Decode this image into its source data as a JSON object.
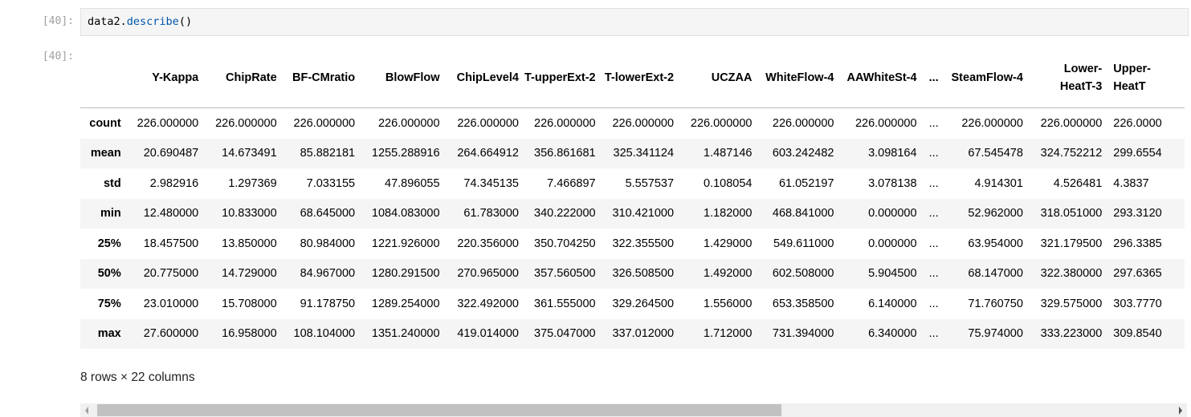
{
  "input": {
    "prompt": "[40]:",
    "code_object": "data2.",
    "code_method": "describe",
    "code_parens": "()"
  },
  "output": {
    "prompt": "[40]:",
    "table": {
      "columns": [
        "Y-Kappa",
        "ChipRate",
        "BF-CMratio",
        "BlowFlow",
        "ChipLevel4",
        "T-upperExt-2",
        "T-lowerExt-2",
        "UCZAA",
        "WhiteFlow-4",
        "AAWhiteSt-4",
        "...",
        "SteamFlow-4",
        "Lower-HeatT-3",
        "Upper-HeatT"
      ],
      "rows": [
        {
          "index": "count",
          "values": [
            "226.000000",
            "226.000000",
            "226.000000",
            "226.000000",
            "226.000000",
            "226.000000",
            "226.000000",
            "226.000000",
            "226.000000",
            "226.000000",
            "...",
            "226.000000",
            "226.000000",
            "226.0000"
          ]
        },
        {
          "index": "mean",
          "values": [
            "20.690487",
            "14.673491",
            "85.882181",
            "1255.288916",
            "264.664912",
            "356.861681",
            "325.341124",
            "1.487146",
            "603.242482",
            "3.098164",
            "...",
            "67.545478",
            "324.752212",
            "299.6554"
          ]
        },
        {
          "index": "std",
          "values": [
            "2.982916",
            "1.297369",
            "7.033155",
            "47.896055",
            "74.345135",
            "7.466897",
            "5.557537",
            "0.108054",
            "61.052197",
            "3.078138",
            "...",
            "4.914301",
            "4.526481",
            "4.3837"
          ]
        },
        {
          "index": "min",
          "values": [
            "12.480000",
            "10.833000",
            "68.645000",
            "1084.083000",
            "61.783000",
            "340.222000",
            "310.421000",
            "1.182000",
            "468.841000",
            "0.000000",
            "...",
            "52.962000",
            "318.051000",
            "293.3120"
          ]
        },
        {
          "index": "25%",
          "values": [
            "18.457500",
            "13.850000",
            "80.984000",
            "1221.926000",
            "220.356000",
            "350.704250",
            "322.355500",
            "1.429000",
            "549.611000",
            "0.000000",
            "...",
            "63.954000",
            "321.179500",
            "296.3385"
          ]
        },
        {
          "index": "50%",
          "values": [
            "20.775000",
            "14.729000",
            "84.967000",
            "1280.291500",
            "270.965000",
            "357.560500",
            "326.508500",
            "1.492000",
            "602.508000",
            "5.904500",
            "...",
            "68.147000",
            "322.380000",
            "297.6365"
          ]
        },
        {
          "index": "75%",
          "values": [
            "23.010000",
            "15.708000",
            "91.178750",
            "1289.254000",
            "322.492000",
            "361.555000",
            "329.264500",
            "1.556000",
            "653.358500",
            "6.140000",
            "...",
            "71.760750",
            "329.575000",
            "303.7770"
          ]
        },
        {
          "index": "max",
          "values": [
            "27.600000",
            "16.958000",
            "108.104000",
            "1351.240000",
            "419.014000",
            "375.047000",
            "337.012000",
            "1.712000",
            "731.394000",
            "6.340000",
            "...",
            "75.974000",
            "333.223000",
            "309.8540"
          ]
        }
      ]
    },
    "summary": "8 rows × 22 columns"
  }
}
